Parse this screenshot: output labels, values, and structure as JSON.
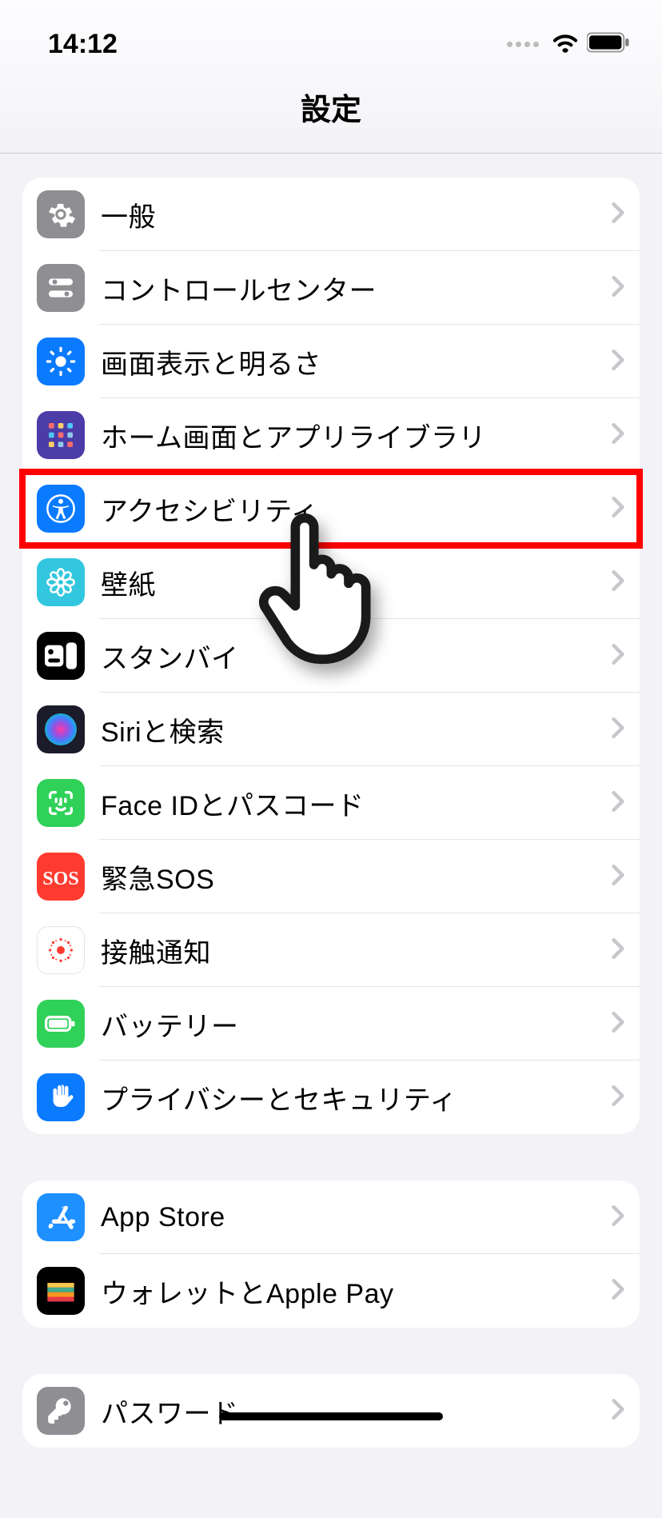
{
  "status": {
    "time": "14:12"
  },
  "nav": {
    "title": "設定"
  },
  "groups": [
    {
      "items": [
        {
          "id": "general",
          "label": "一般",
          "icon": "gear",
          "bg": "#8e8e93"
        },
        {
          "id": "controlcenter",
          "label": "コントロールセンター",
          "icon": "switches",
          "bg": "#8e8e93"
        },
        {
          "id": "display",
          "label": "画面表示と明るさ",
          "icon": "sun",
          "bg": "#0a7aff"
        },
        {
          "id": "home",
          "label": "ホーム画面とアプリライブラリ",
          "icon": "grid",
          "bg": "#4b3ca8"
        },
        {
          "id": "accessibility",
          "label": "アクセシビリティ",
          "icon": "accessibility",
          "bg": "#0a7aff"
        },
        {
          "id": "wallpaper",
          "label": "壁紙",
          "icon": "flower",
          "bg": "#32c7de"
        },
        {
          "id": "standby",
          "label": "スタンバイ",
          "icon": "standby",
          "bg": "#000000"
        },
        {
          "id": "siri",
          "label": "Siriと検索",
          "icon": "siri",
          "bg": "#1b1b2a"
        },
        {
          "id": "faceid",
          "label": "Face IDとパスコード",
          "icon": "faceid",
          "bg": "#30d158"
        },
        {
          "id": "sos",
          "label": "緊急SOS",
          "icon": "sos",
          "bg": "#ff3b30"
        },
        {
          "id": "exposure",
          "label": "接触通知",
          "icon": "exposure",
          "bg": "#ffffff"
        },
        {
          "id": "battery",
          "label": "バッテリー",
          "icon": "battery",
          "bg": "#30d158"
        },
        {
          "id": "privacy",
          "label": "プライバシーとセキュリティ",
          "icon": "hand",
          "bg": "#0a7aff"
        }
      ]
    },
    {
      "items": [
        {
          "id": "appstore",
          "label": "App Store",
          "icon": "appstore",
          "bg": "#1e90ff"
        },
        {
          "id": "wallet",
          "label": "ウォレットとApple Pay",
          "icon": "wallet",
          "bg": "#000000"
        }
      ]
    },
    {
      "items": [
        {
          "id": "passwords",
          "label": "パスワード",
          "icon": "key",
          "bg": "#8e8e93"
        }
      ]
    }
  ],
  "annotation": {
    "highlight_item": "accessibility"
  }
}
